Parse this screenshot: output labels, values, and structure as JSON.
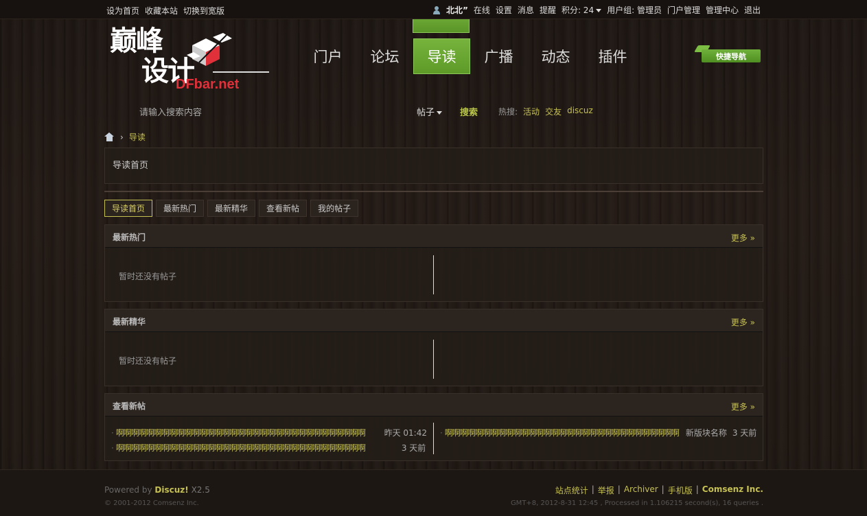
{
  "topbar": {
    "left_links": [
      "设为首页",
      "收藏本站",
      "切换到宽版"
    ],
    "username": "北北”",
    "online": "在线",
    "settings": "设置",
    "messages": "消息",
    "reminders": "提醒",
    "points": "积分: 24",
    "usergroup_label": "用户组: 管理员",
    "portal_admin": "门户管理",
    "admin_center": "管理中心",
    "logout": "退出"
  },
  "logo": {
    "cn_top": "巅峰",
    "cn_bottom": "设计",
    "latin": "DFbar.net"
  },
  "nav": {
    "items": [
      "门户",
      "论坛",
      "导读",
      "广播",
      "动态",
      "插件"
    ],
    "active": "导读"
  },
  "quick_nav": "快捷导航",
  "search": {
    "placeholder": "请输入搜索内容",
    "type": "帖子",
    "button": "搜索",
    "hot_label": "热搜:",
    "hot_keywords": [
      "活动",
      "交友",
      "discuz"
    ]
  },
  "breadcrumb": {
    "current": "导读"
  },
  "guide": {
    "title": "导读首页"
  },
  "tabs": {
    "items": [
      "导读首页",
      "最新热门",
      "最新精华",
      "查看新帖",
      "我的帖子"
    ],
    "active": "导读首页"
  },
  "sections": {
    "hot": {
      "title": "最新热门",
      "more": "更多 »",
      "empty": "暂时还没有帖子"
    },
    "digest": {
      "title": "最新精华",
      "more": "更多 »",
      "empty": "暂时还没有帖子"
    },
    "new": {
      "title": "查看新帖",
      "more": "更多 »",
      "left_posts": [
        {
          "title": "啊啊啊啊啊啊啊啊啊啊啊啊啊啊啊啊啊啊啊啊啊啊啊啊啊啊啊啊啊啊啊啊啊",
          "time": "昨天 01:42"
        },
        {
          "title": "啊啊啊啊啊啊啊啊啊啊啊啊啊啊啊啊啊啊啊啊啊啊啊啊啊啊啊啊啊啊啊啊啊",
          "time": "3 天前"
        }
      ],
      "right_posts": [
        {
          "title": "啊啊啊啊啊啊啊啊啊啊啊啊啊啊啊啊啊啊啊啊啊啊啊啊啊啊啊啊啊啊啊",
          "forum": "新版块名称",
          "time": "3 天前"
        }
      ]
    }
  },
  "footer": {
    "powered_prefix": "Powered by",
    "powered_brand": "Discuz!",
    "powered_version": "X2.5",
    "copyright": "© 2001-2012 Comsenz Inc.",
    "links": [
      "站点统计",
      "举报",
      "Archiver",
      "手机版"
    ],
    "brand": "Comsenz Inc.",
    "stats": "GMT+8, 2012-8-31 12:45 , Processed in 1.106215 second(s), 16 queries ."
  },
  "colors": {
    "accent_green": "#6aa634",
    "link_yellow": "#c5c052",
    "background": "#211a15"
  }
}
